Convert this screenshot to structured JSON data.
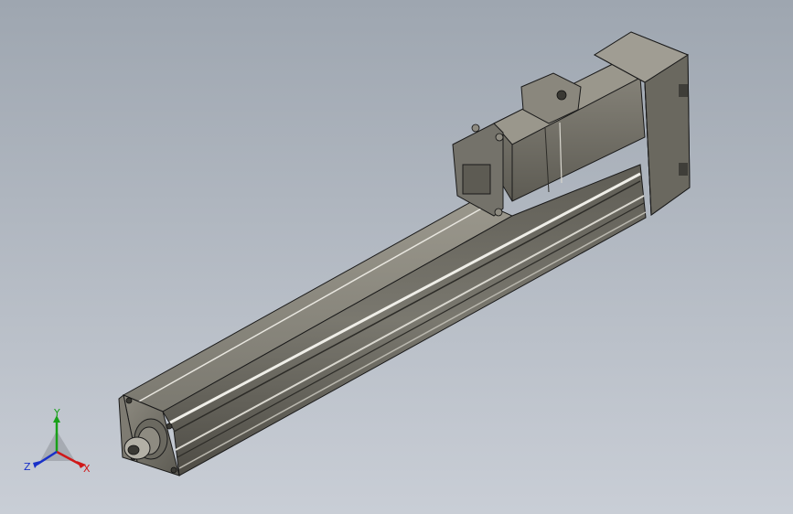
{
  "viewport": {
    "background_top": "#9ea6b0",
    "background_bottom": "#c9ced6",
    "model_body_color": "#6e6c63",
    "model_edge_color": "#1a1a1a"
  },
  "triad": {
    "x_label": "X",
    "y_label": "Y",
    "z_label": "Z",
    "x_color": "#d01818",
    "y_color": "#18a018",
    "z_color": "#1830c8"
  }
}
